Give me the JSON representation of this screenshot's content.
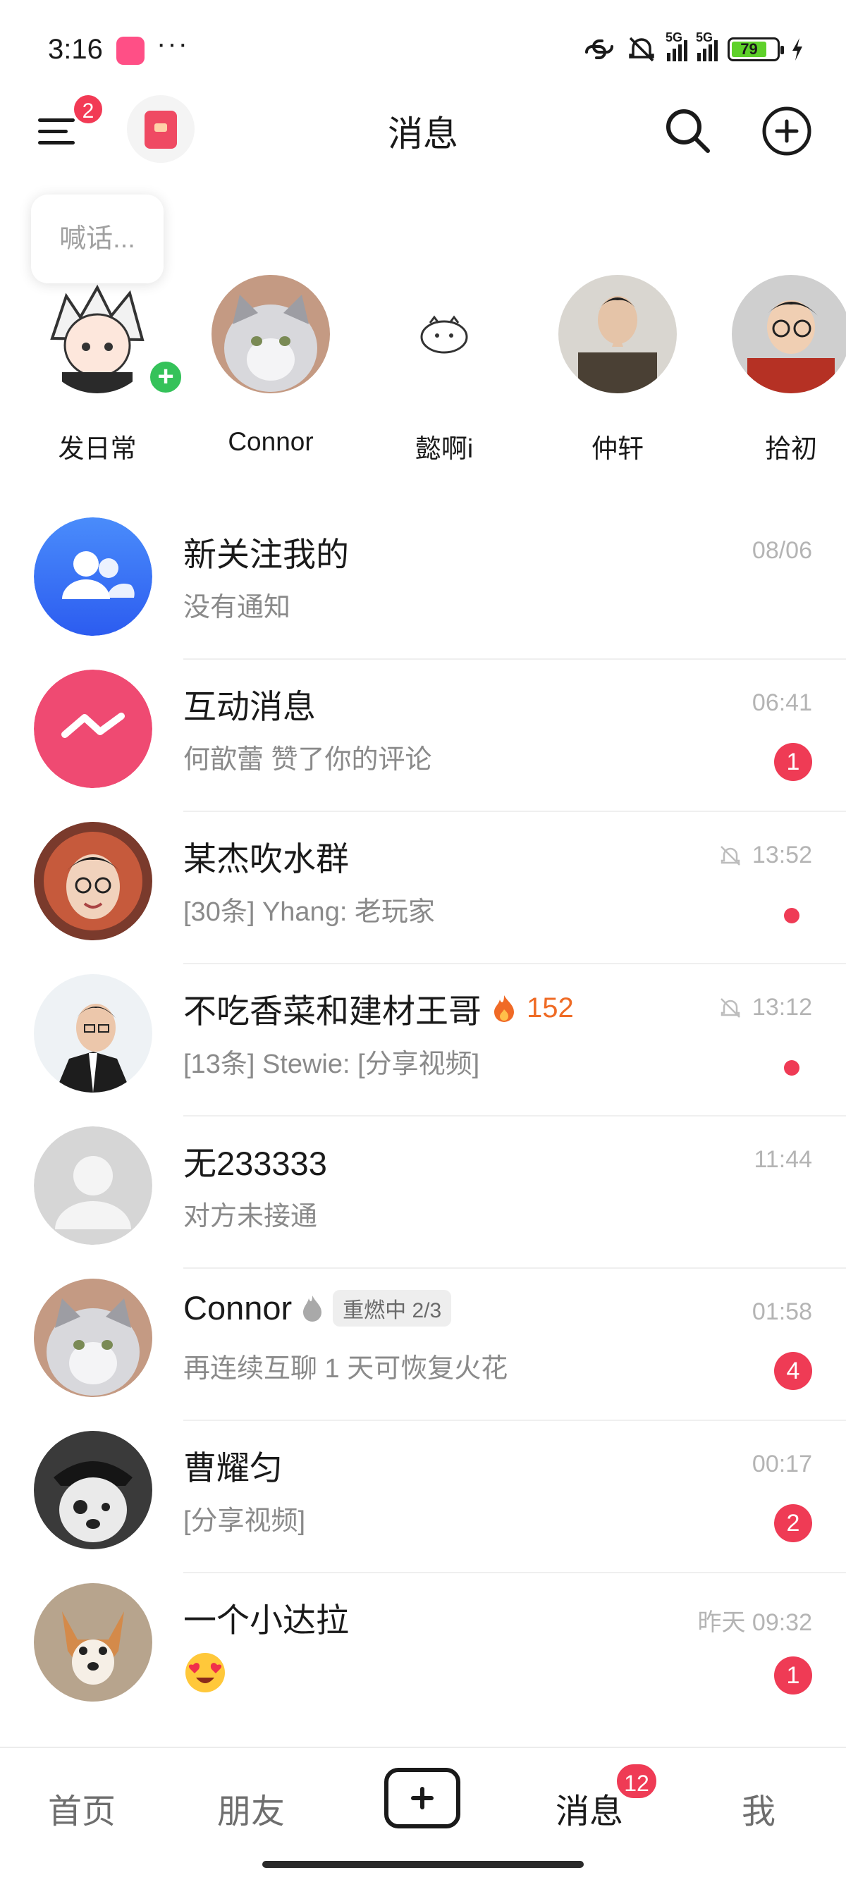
{
  "status_bar": {
    "time": "3:16",
    "dots": "···",
    "network_left": "5G",
    "network_right": "5G",
    "battery": "79"
  },
  "header": {
    "title": "消息",
    "menu_badge": "2"
  },
  "shout_bubble": "喊话...",
  "stories": [
    {
      "name": "发日常"
    },
    {
      "name": "Connor"
    },
    {
      "name": "懿啊i"
    },
    {
      "name": "仲轩"
    },
    {
      "name": "拾初"
    }
  ],
  "messages": [
    {
      "title": "新关注我的",
      "subtitle": "没有通知",
      "time": "08/06"
    },
    {
      "title": "互动消息",
      "subtitle": "何歆蕾 赞了你的评论",
      "time": "06:41",
      "badge": "1"
    },
    {
      "title": "某杰吹水群",
      "subtitle": "[30条] Yhang: 老玩家",
      "time": "13:52"
    },
    {
      "title": "不吃香菜和建材王哥",
      "fire_count": "152",
      "subtitle": "[13条] Stewie: [分享视频]",
      "time": "13:12"
    },
    {
      "title": "无233333",
      "subtitle": "对方未接通",
      "time": "11:44"
    },
    {
      "title": "Connor",
      "tag": "重燃中 2/3",
      "subtitle": "再连续互聊 1 天可恢复火花",
      "time": "01:58",
      "badge": "4"
    },
    {
      "title": "曹耀匀",
      "subtitle": "[分享视频]",
      "time": "00:17",
      "badge": "2"
    },
    {
      "title": "一个小达拉",
      "subtitle": "",
      "time": "昨天 09:32",
      "badge": "1"
    }
  ],
  "bottom_nav": {
    "home": "首页",
    "friends": "朋友",
    "messages": "消息",
    "me": "我",
    "messages_badge": "12"
  },
  "colors": {
    "accent": "#ef3b55",
    "muted_text": "#8a8a8a",
    "time_text": "#b4b4b4",
    "fire": "#ef6b25"
  },
  "icons": [
    "menu-icon",
    "red-packet-icon",
    "search-icon",
    "add-circle-icon",
    "users-icon",
    "interaction-icon",
    "mute-bell-icon",
    "fire-icon",
    "add-square-icon"
  ]
}
